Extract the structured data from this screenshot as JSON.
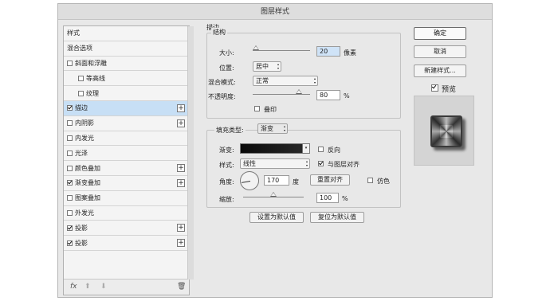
{
  "dialog": {
    "title": "图层样式"
  },
  "styles_list": {
    "items": [
      {
        "label": "样式",
        "checkbox": false,
        "checked": false,
        "plus": false,
        "indent": false,
        "selected": false
      },
      {
        "label": "混合选项",
        "checkbox": false,
        "checked": false,
        "plus": false,
        "indent": false,
        "selected": false
      },
      {
        "label": "斜面和浮雕",
        "checkbox": true,
        "checked": false,
        "plus": false,
        "indent": false,
        "selected": false
      },
      {
        "label": "等高线",
        "checkbox": true,
        "checked": false,
        "plus": false,
        "indent": true,
        "selected": false
      },
      {
        "label": "纹理",
        "checkbox": true,
        "checked": false,
        "plus": false,
        "indent": true,
        "selected": false
      },
      {
        "label": "描边",
        "checkbox": true,
        "checked": true,
        "plus": true,
        "indent": false,
        "selected": true
      },
      {
        "label": "内阴影",
        "checkbox": true,
        "checked": false,
        "plus": true,
        "indent": false,
        "selected": false
      },
      {
        "label": "内发光",
        "checkbox": true,
        "checked": false,
        "plus": false,
        "indent": false,
        "selected": false
      },
      {
        "label": "光泽",
        "checkbox": true,
        "checked": false,
        "plus": false,
        "indent": false,
        "selected": false
      },
      {
        "label": "颜色叠加",
        "checkbox": true,
        "checked": false,
        "plus": true,
        "indent": false,
        "selected": false
      },
      {
        "label": "渐变叠加",
        "checkbox": true,
        "checked": true,
        "plus": true,
        "indent": false,
        "selected": false
      },
      {
        "label": "图案叠加",
        "checkbox": true,
        "checked": false,
        "plus": false,
        "indent": false,
        "selected": false
      },
      {
        "label": "外发光",
        "checkbox": true,
        "checked": false,
        "plus": false,
        "indent": false,
        "selected": false
      },
      {
        "label": "投影",
        "checkbox": true,
        "checked": true,
        "plus": true,
        "indent": false,
        "selected": false
      },
      {
        "label": "投影",
        "checkbox": true,
        "checked": true,
        "plus": true,
        "indent": false,
        "selected": false
      }
    ],
    "footer": {
      "fx": "fx",
      "up": "⬆",
      "down": "⬇",
      "trash": "🗑"
    }
  },
  "stroke": {
    "section_title": "描边",
    "structure_title": "结构",
    "size_label": "大小:",
    "size_value": "20",
    "size_unit": "像素",
    "size_level": 0.05,
    "position_label": "位置:",
    "position_value": "居中",
    "blend_label": "混合模式:",
    "blend_value": "正常",
    "opacity_label": "不透明度:",
    "opacity_value": "80",
    "opacity_unit": "%",
    "opacity_level": 0.8,
    "overprint_label": "叠印",
    "fill_type_label": "填充类型:",
    "fill_type_value": "渐变",
    "gradient_label": "渐变:",
    "reverse_label": "反向",
    "style_label": "样式:",
    "style_value": "线性",
    "align_label": "与图层对齐",
    "angle_label": "角度:",
    "angle_value": "170",
    "angle_unit": "度",
    "reset_align_label": "重置对齐",
    "dither_label": "仿色",
    "scale_label": "缩放:",
    "scale_value": "100",
    "scale_unit": "%",
    "scale_level": 0.5,
    "set_default_label": "设置为默认值",
    "reset_default_label": "复位为默认值"
  },
  "buttons": {
    "ok": "确定",
    "cancel": "取消",
    "new_style": "新建样式...",
    "preview_label": "预览"
  },
  "colors": {
    "selected_row": "#c7dff5",
    "dialog_bg": "#e8e8e8"
  }
}
